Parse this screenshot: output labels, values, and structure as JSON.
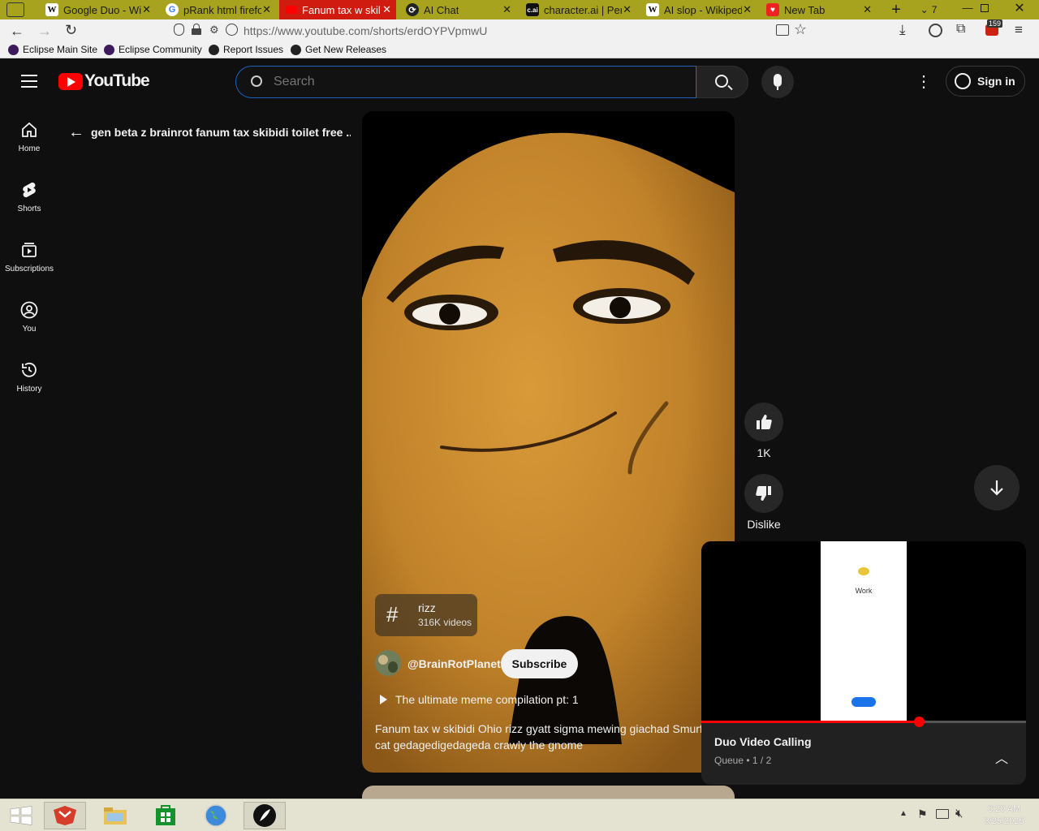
{
  "browser": {
    "tabs": [
      {
        "label": "Google Duo - Wi",
        "icon": "wikipedia-icon",
        "active": false
      },
      {
        "label": "pRank html firefo",
        "icon": "google-icon",
        "active": false
      },
      {
        "label": "Fanum tax w skib",
        "icon": "youtube-icon",
        "active": true
      },
      {
        "label": "AI Chat",
        "icon": "ai-chat-icon",
        "active": false
      },
      {
        "label": "character.ai | Pers",
        "icon": "characterai-icon",
        "active": false
      },
      {
        "label": "AI slop - Wikiped",
        "icon": "wikipedia-icon",
        "active": false
      },
      {
        "label": "New Tab",
        "icon": "new-tab-icon",
        "active": false
      }
    ],
    "tab_count": "7",
    "url": "https://www.youtube.com/shorts/erdOYPVpmwU",
    "url_host": "youtube.com",
    "extension_badge": "159",
    "bookmarks": [
      {
        "label": "Eclipse Main Site",
        "icon": "eclipse-icon"
      },
      {
        "label": "Eclipse Community",
        "icon": "eclipse-icon"
      },
      {
        "label": "Report Issues",
        "icon": "github-icon"
      },
      {
        "label": "Get New Releases",
        "icon": "github-icon"
      }
    ]
  },
  "youtube": {
    "logo_text": "YouTube",
    "search_placeholder": "Search",
    "sign_in": "Sign in",
    "sidebar": [
      {
        "label": "Home",
        "icon": "home-icon"
      },
      {
        "label": "Shorts",
        "icon": "shorts-icon"
      },
      {
        "label": "Subscriptions",
        "icon": "subscriptions-icon"
      },
      {
        "label": "You",
        "icon": "you-icon"
      },
      {
        "label": "History",
        "icon": "history-icon"
      }
    ],
    "short_title": "gen beta z brainrot fanum tax skibidi toilet free ...",
    "hashtag": {
      "tag": "rizz",
      "count": "316K videos"
    },
    "channel": "@BrainRotPlanet",
    "subscribe": "Subscribe",
    "playlist": "The ultimate meme compilation pt: 1",
    "description_line1": "Fanum tax w skibidi Ohio rizz gyatt sigma mewing giachad Smurf",
    "description_line2": "cat gedagedigedageda crawly the gnome",
    "likes": "1K",
    "dislike_label": "Dislike"
  },
  "miniplayer": {
    "title": "Duo Video Calling",
    "queue": "Queue • 1 / 2",
    "screen_heading": "Work",
    "progress": 0.67
  },
  "taskbar": {
    "time": "6:20 AM",
    "date": "3/25/2025"
  },
  "colors": {
    "youtube_red": "#ff0000",
    "tab_bar": "#a8a31e",
    "active_tab": "#cf1b10",
    "page_bg": "#0f0f0f",
    "nugget": "#c98a2e"
  }
}
